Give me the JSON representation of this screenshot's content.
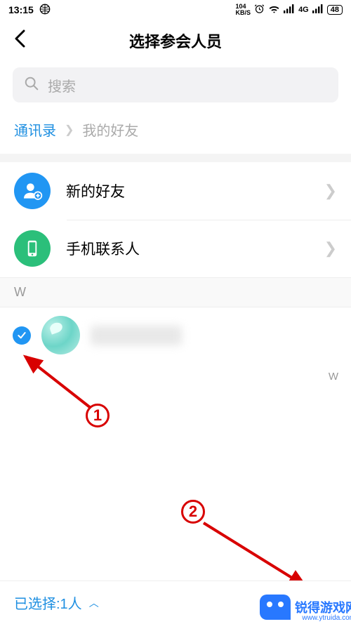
{
  "statusbar": {
    "time": "13:15",
    "net_speed": "104",
    "net_unit": "KB/S",
    "network_label": "4G",
    "battery": "48"
  },
  "header": {
    "title": "选择参会人员"
  },
  "search": {
    "placeholder": "搜索"
  },
  "breadcrumb": {
    "root": "通讯录",
    "current": "我的好友"
  },
  "shortcuts": {
    "new_friend": "新的好友",
    "phone_contacts": "手机联系人"
  },
  "section": {
    "letter": "W"
  },
  "index": {
    "letter": "W"
  },
  "footer": {
    "selected_label": "已选择:1人"
  },
  "annotations": {
    "one": "1",
    "two": "2"
  },
  "watermark": {
    "brand": "锐得游戏网",
    "url": "www.ytruida.com"
  }
}
